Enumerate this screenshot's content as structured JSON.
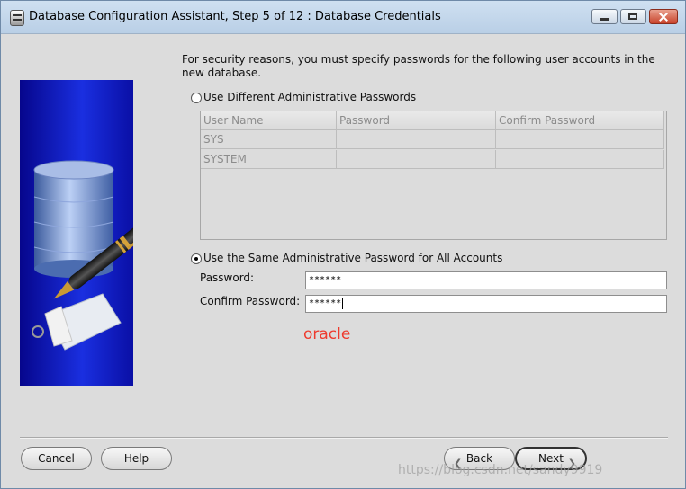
{
  "window": {
    "title": "Database Configuration Assistant, Step 5 of 12 : Database Credentials"
  },
  "intro_text": "For security reasons, you must specify passwords for the following user accounts in the new database.",
  "option_different": {
    "label": "Use Different Administrative Passwords",
    "selected": false
  },
  "table": {
    "headers": [
      "User Name",
      "Password",
      "Confirm Password"
    ],
    "rows": [
      {
        "user": "SYS",
        "password": "",
        "confirm": ""
      },
      {
        "user": "SYSTEM",
        "password": "",
        "confirm": ""
      }
    ]
  },
  "option_same": {
    "label": "Use the Same Administrative Password for All Accounts",
    "selected": true
  },
  "fields": {
    "password_label": "Password:",
    "password_value": "******",
    "confirm_label": "Confirm Password:",
    "confirm_value": "******"
  },
  "annotation": "oracle",
  "buttons": {
    "cancel": "Cancel",
    "help": "Help",
    "back": "Back",
    "next": "Next"
  },
  "watermark": "https://blog.csdn.net/sandy9919",
  "colors": {
    "annotation": "#ee3b2e",
    "panel_blue": "#1a2fe0",
    "window_bg": "#dcdcdc"
  },
  "icons": [
    "app-icon",
    "minimize-icon",
    "maximize-icon",
    "close-icon",
    "database-pen-illustration",
    "back-arrow-icon",
    "next-arrow-icon"
  ]
}
